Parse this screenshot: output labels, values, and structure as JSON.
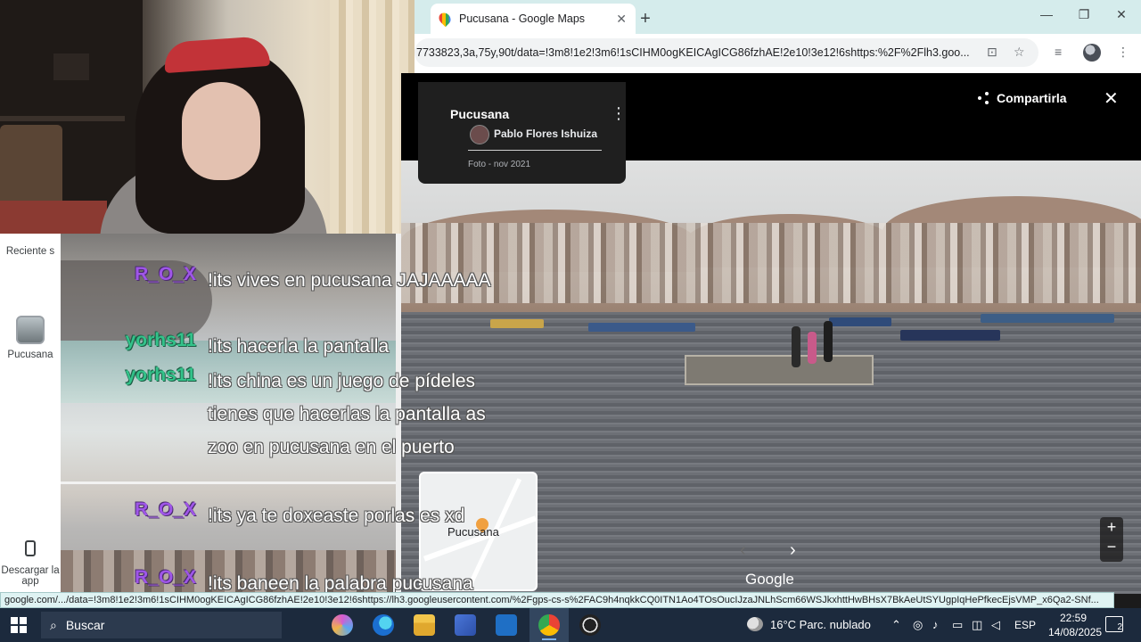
{
  "browser": {
    "tab_title": "Pucusana - Google Maps",
    "url": "7733823,3a,75y,90t/data=!3m8!1e2!3m6!1sCIHM0ogKEICAgICG86fzhAE!2e10!3e12!6shttps:%2F%2Flh3.goo..."
  },
  "maps_sidebar": {
    "recent_label": "Reciente s",
    "place_label": "Pucusana",
    "download_label": "Descargar la app"
  },
  "photo_viewer": {
    "place_title": "Pucusana",
    "author": "Pablo Flores Ishuiza",
    "date": "Foto - nov 2021",
    "share_label": "Compartirla",
    "minimap_label": "Pucusana",
    "brand": "Google"
  },
  "chat": [
    {
      "user": "R_O_X",
      "color": "#9f56e8",
      "text": "!its vives en pucusana JAJAAAAA"
    },
    {
      "user": "yorhs11",
      "color": "#33c28a",
      "text": "!its hacerla la pantalla"
    },
    {
      "user": "yorhs11",
      "color": "#33c28a",
      "text": "!its china es un juego de pídeles tienes que hacerlas la pantalla as zoo en pucusana en el puerto"
    },
    {
      "user": "R_O_X",
      "color": "#9f56e8",
      "text": "!its ya te doxeaste porlas es xd"
    },
    {
      "user": "R_O_X",
      "color": "#9f56e8",
      "text": "!its baneen la palabra pucusana"
    }
  ],
  "status_url": "google.com/.../data=!3m8!1e2!3m6!1sCIHM0ogKEICAgICG86fzhAE!2e10!3e12!6shttps://lh3.googleusercontent.com/%2Fgps-cs-s%2FAC9h4nqkkCQ0ITN1Ao4TOsOucIJzaJNLhScm66WSJkxhttHwBHsX7BkAeUtSYUgpIqHePfkecEjsVMP_x6Qa2-SNf...",
  "taskbar": {
    "search_placeholder": "Buscar",
    "weather": "16°C  Parc. nublado",
    "lang": "ESP",
    "time": "22:59",
    "date": "14/08/2025",
    "notifications": "2"
  },
  "icons": [
    "map-pin-icon",
    "close-icon",
    "plus-icon",
    "minimize-icon",
    "restore-icon",
    "install-icon",
    "star-icon",
    "media-icon",
    "menu-dots-icon",
    "share-icon",
    "chevron-left-icon",
    "chevron-right-icon",
    "zoom-in-icon",
    "zoom-out-icon",
    "windows-start-icon",
    "search-icon",
    "weather-icon"
  ]
}
